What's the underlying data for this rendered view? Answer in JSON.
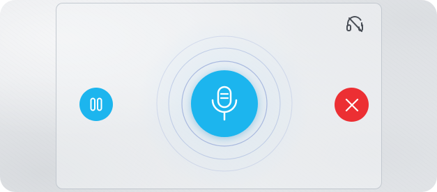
{
  "voice_widget": {
    "state": "listening",
    "colors": {
      "accent": "#1cb5ee",
      "danger": "#ec2f33",
      "ring": "#8fa3d6",
      "icon_dark": "#4a4f57",
      "icon_light": "#ffffff"
    },
    "controls": {
      "pause": {
        "icon": "pause-icon"
      },
      "microphone": {
        "icon": "microphone-icon"
      },
      "close": {
        "icon": "close-icon"
      },
      "headset": {
        "icon": "headset-off-icon"
      }
    }
  }
}
